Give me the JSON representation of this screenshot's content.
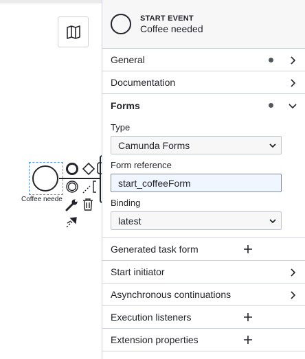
{
  "canvas": {
    "map_icon": "map-icon",
    "event_label": "Coffee neede",
    "context_pad_icons": [
      "end-event-icon",
      "gateway-icon",
      "task-icon",
      "intermediate-event-icon",
      "text-annotation-icon",
      "wrench-icon",
      "trash-icon",
      "connect-icon"
    ]
  },
  "panel": {
    "header": {
      "type": "START EVENT",
      "name": "Coffee needed",
      "icon": "start-event-icon"
    },
    "groups": {
      "general": {
        "label": "General",
        "has_data": true
      },
      "documentation": {
        "label": "Documentation"
      },
      "forms": {
        "label": "Forms",
        "has_data": true,
        "type_label": "Type",
        "type_value": "Camunda Forms",
        "reference_label": "Form reference",
        "reference_value": "start_coffeeForm",
        "binding_label": "Binding",
        "binding_value": "latest"
      },
      "generated_task_form": {
        "label": "Generated task form"
      },
      "start_initiator": {
        "label": "Start initiator"
      },
      "async_continuations": {
        "label": "Asynchronous continuations"
      },
      "execution_listeners": {
        "label": "Execution listeners"
      },
      "extension_properties": {
        "label": "Extension properties"
      }
    }
  },
  "colors": {
    "selection": "#4d90ff",
    "border": "#cfd2d8",
    "header_bg": "#f7f7f8",
    "text": "#22242a"
  }
}
